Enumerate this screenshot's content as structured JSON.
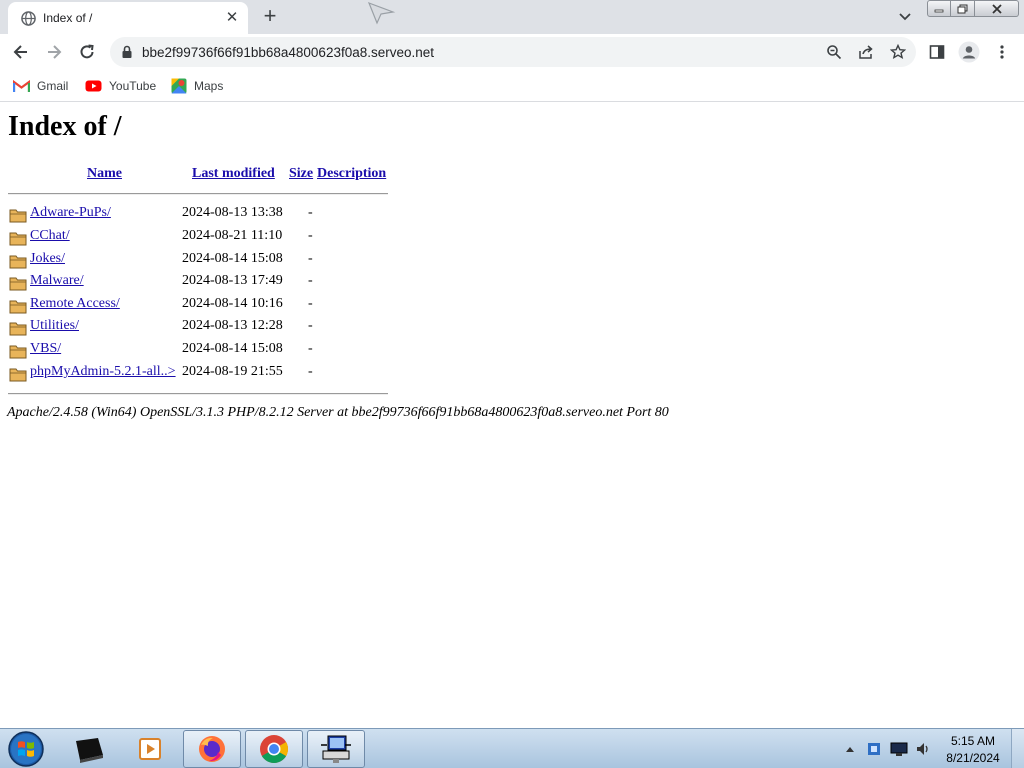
{
  "browser": {
    "tab": {
      "title": "Index of /",
      "close": "✕"
    },
    "new_tab": "+",
    "url": "bbe2f99736f66f91bb68a4800623f0a8.serveo.net",
    "bookmarks": [
      {
        "label": "Gmail",
        "icon": "gmail-icon"
      },
      {
        "label": "YouTube",
        "icon": "youtube-icon"
      },
      {
        "label": "Maps",
        "icon": "maps-icon"
      }
    ]
  },
  "page": {
    "title": "Index of /",
    "columns": {
      "name": "Name",
      "last_modified": "Last modified",
      "size": "Size",
      "description": "Description"
    },
    "rows": [
      {
        "name": "Adware-PuPs/",
        "modified": "2024-08-13 13:38",
        "size": "-"
      },
      {
        "name": "CChat/",
        "modified": "2024-08-21 11:10",
        "size": "-"
      },
      {
        "name": "Jokes/",
        "modified": "2024-08-14 15:08",
        "size": "-"
      },
      {
        "name": "Malware/",
        "modified": "2024-08-13 17:49",
        "size": "-"
      },
      {
        "name": "Remote Access/",
        "modified": "2024-08-14 10:16",
        "size": "-"
      },
      {
        "name": "Utilities/",
        "modified": "2024-08-13 12:28",
        "size": "-"
      },
      {
        "name": "VBS/",
        "modified": "2024-08-14 15:08",
        "size": "-"
      },
      {
        "name": "phpMyAdmin-5.2.1-all..>",
        "modified": "2024-08-19 21:55",
        "size": "-"
      }
    ],
    "address": "Apache/2.4.58 (Win64) OpenSSL/3.1.3 PHP/8.2.12 Server at bbe2f99736f66f91bb68a4800623f0a8.serveo.net Port 80"
  },
  "taskbar": {
    "clock_time": "5:15 AM",
    "clock_date": "8/21/2024",
    "apps": [
      "terminal-icon",
      "media-player-icon",
      "firefox-icon",
      "chrome-icon",
      "network-computer-icon"
    ]
  },
  "colors": {
    "link": "#1a0dab",
    "tab_strip": "#dee1e6",
    "omnibox": "#f1f3f4"
  }
}
